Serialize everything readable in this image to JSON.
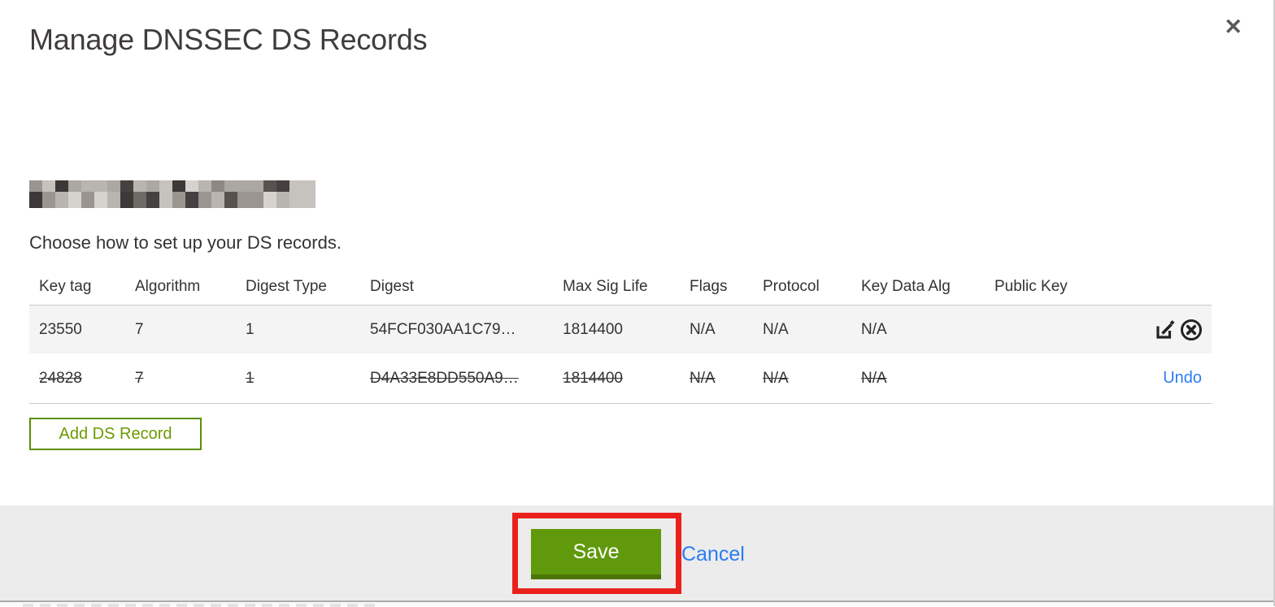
{
  "modal": {
    "title": "Manage DNSSEC DS Records",
    "close_label": "✕",
    "instructions": "Choose how to set up your DS records.",
    "table": {
      "headers": {
        "key_tag": "Key tag",
        "algorithm": "Algorithm",
        "digest_type": "Digest Type",
        "digest": "Digest",
        "max_sig_life": "Max Sig Life",
        "flags": "Flags",
        "protocol": "Protocol",
        "key_data_alg": "Key Data Alg",
        "public_key": "Public Key"
      },
      "rows": [
        {
          "key_tag": "23550",
          "algorithm": "7",
          "digest_type": "1",
          "digest": "54FCF030AA1C79…",
          "max_sig_life": "1814400",
          "flags": "N/A",
          "protocol": "N/A",
          "key_data_alg": "N/A",
          "public_key": "",
          "state": "active",
          "actions": [
            "edit",
            "delete"
          ]
        },
        {
          "key_tag": "24828",
          "algorithm": "7",
          "digest_type": "1",
          "digest": "D4A33E8DD550A9…",
          "max_sig_life": "1814400",
          "flags": "N/A",
          "protocol": "N/A",
          "key_data_alg": "N/A",
          "public_key": "",
          "state": "deleted",
          "undo_label": "Undo"
        }
      ]
    },
    "add_button_label": "Add DS Record",
    "footer": {
      "save_label": "Save",
      "cancel_label": "Cancel"
    }
  },
  "colors": {
    "accent_green": "#61990c",
    "green_border": "#5b8f02",
    "link_blue": "#2b7cf2",
    "annotation_red": "#e9211c",
    "footer_gray": "#ececec",
    "row_gray": "#f5f4f4"
  }
}
